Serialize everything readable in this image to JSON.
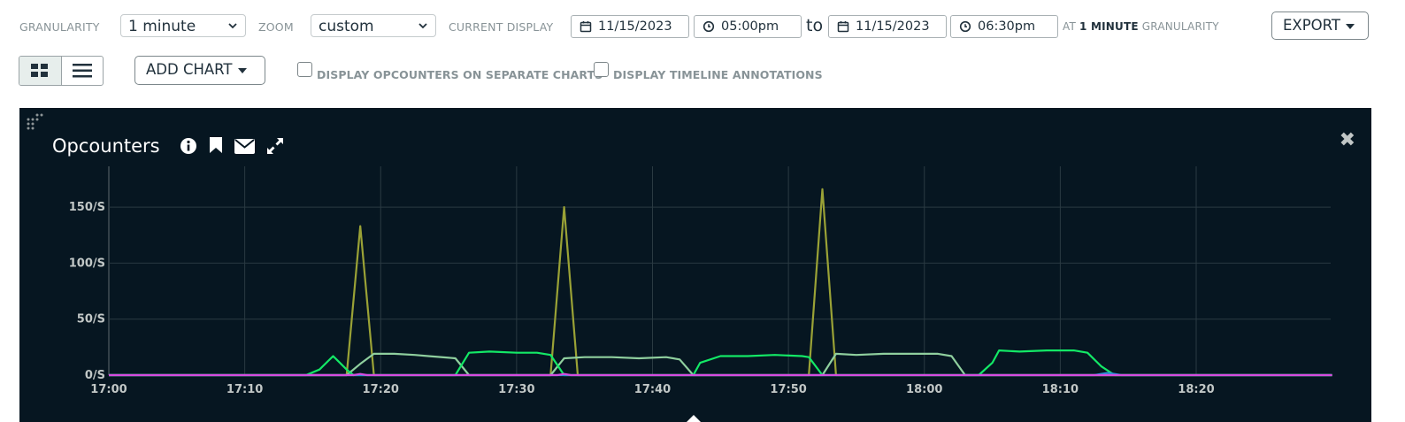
{
  "toolbar": {
    "granularity_label": "GRANULARITY",
    "granularity_value": "1 minute",
    "zoom_label": "ZOOM",
    "zoom_value": "custom",
    "current_display_label": "CURRENT DISPLAY",
    "start_date": "11/15/2023",
    "start_time": "05:00pm",
    "to_text": "to",
    "end_date": "11/15/2023",
    "end_time": "06:30pm",
    "at_text": "AT",
    "granularity_bold": "1 MINUTE",
    "granularity_suffix": "GRANULARITY",
    "export_label": "EXPORT"
  },
  "controls": {
    "add_chart_label": "ADD CHART",
    "separate_charts_label": "DISPLAY OPCOUNTERS ON SEPARATE CHARTS",
    "separate_charts_checked": false,
    "annotations_label": "DISPLAY TIMELINE ANNOTATIONS",
    "annotations_checked": false,
    "view_mode": "list"
  },
  "panel": {
    "title": "Opcounters",
    "icons": [
      "info-icon",
      "bookmark-icon",
      "envelope-icon",
      "expand-icon"
    ],
    "close_icon": "close-icon",
    "background": "#061621"
  },
  "chart_data": {
    "type": "line",
    "title": "Opcounters",
    "xlabel": "",
    "ylabel": "",
    "x_ticks": [
      "17:00",
      "17:10",
      "17:20",
      "17:30",
      "17:40",
      "17:50",
      "18:00",
      "18:10",
      "18:20"
    ],
    "y_ticks": [
      "0/S",
      "50/S",
      "100/S",
      "150/S"
    ],
    "xlim_minutes": [
      0,
      90
    ],
    "ylim": [
      0,
      185
    ],
    "grid": true,
    "series": [
      {
        "color": "#9aa236",
        "points": [
          [
            0,
            0
          ],
          [
            17.5,
            0
          ],
          [
            18.5,
            133
          ],
          [
            19.5,
            0
          ],
          [
            32.5,
            0
          ],
          [
            33.5,
            150
          ],
          [
            34.5,
            0
          ],
          [
            51.5,
            0
          ],
          [
            52.5,
            166
          ],
          [
            53.5,
            0
          ],
          [
            90,
            0
          ]
        ]
      },
      {
        "color": "#8fcf9e",
        "points": [
          [
            0,
            0
          ],
          [
            17.5,
            0
          ],
          [
            18.5,
            10
          ],
          [
            19.5,
            19
          ],
          [
            21,
            19
          ],
          [
            22.5,
            18
          ],
          [
            23.5,
            17
          ],
          [
            25.5,
            15
          ],
          [
            26.5,
            0
          ],
          [
            32.5,
            0
          ],
          [
            33.5,
            15
          ],
          [
            35,
            16
          ],
          [
            37,
            16
          ],
          [
            39,
            15
          ],
          [
            41,
            16
          ],
          [
            42,
            14
          ],
          [
            43,
            0
          ],
          [
            52.5,
            0
          ],
          [
            53.5,
            19
          ],
          [
            55,
            18
          ],
          [
            57,
            19
          ],
          [
            59,
            19
          ],
          [
            61,
            19
          ],
          [
            62,
            17
          ],
          [
            63,
            0
          ],
          [
            90,
            0
          ]
        ]
      },
      {
        "color": "#13e866",
        "points": [
          [
            0,
            0
          ],
          [
            14.5,
            0
          ],
          [
            15.5,
            5
          ],
          [
            16.5,
            17
          ],
          [
            17.5,
            5
          ],
          [
            18,
            0
          ],
          [
            25.5,
            0
          ],
          [
            26.5,
            20
          ],
          [
            28,
            21
          ],
          [
            30,
            20
          ],
          [
            31.5,
            20
          ],
          [
            32.5,
            18
          ],
          [
            33.5,
            0
          ],
          [
            43,
            0
          ],
          [
            43.5,
            11
          ],
          [
            45,
            17
          ],
          [
            47,
            17
          ],
          [
            49,
            18
          ],
          [
            51,
            17
          ],
          [
            51.5,
            16
          ],
          [
            52.5,
            0
          ],
          [
            64,
            0
          ],
          [
            65,
            11
          ],
          [
            65.5,
            22
          ],
          [
            67,
            21
          ],
          [
            69,
            22
          ],
          [
            71,
            22
          ],
          [
            72,
            20
          ],
          [
            73,
            8
          ],
          [
            74,
            0
          ],
          [
            90,
            0
          ]
        ]
      },
      {
        "color": "#2b8fd6",
        "points": [
          [
            0,
            0
          ],
          [
            72.5,
            0
          ],
          [
            73.5,
            2
          ],
          [
            74.5,
            0
          ],
          [
            90,
            0
          ]
        ]
      },
      {
        "color": "#d64ce0",
        "points": [
          [
            0,
            0
          ],
          [
            18,
            0
          ],
          [
            18.5,
            1
          ],
          [
            19,
            0
          ],
          [
            33,
            0
          ],
          [
            33.5,
            1
          ],
          [
            34,
            0
          ],
          [
            90,
            0
          ]
        ]
      }
    ]
  }
}
